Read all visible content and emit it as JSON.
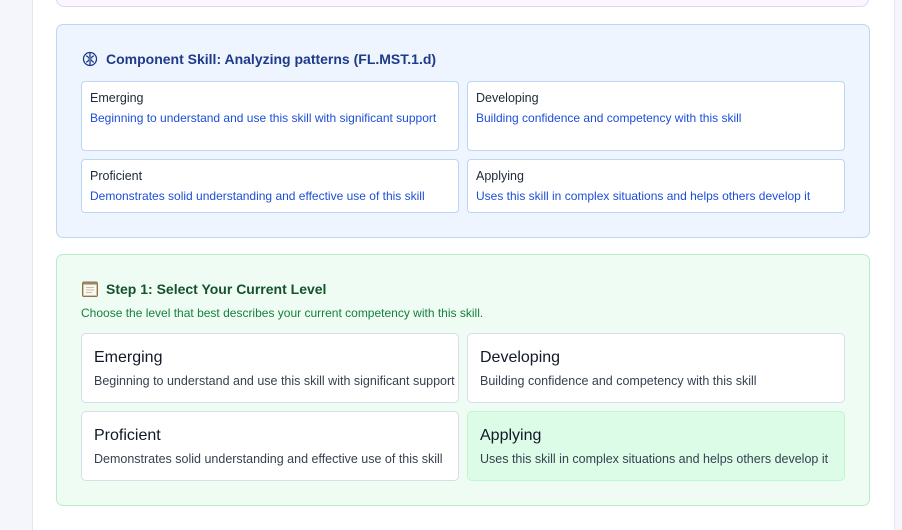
{
  "component": {
    "title": "Component Skill: Analyzing patterns (FL.MST.1.d)",
    "levels": [
      {
        "name": "Emerging",
        "desc": "Beginning to understand and use this skill with significant support"
      },
      {
        "name": "Developing",
        "desc": "Building confidence and competency with this skill"
      },
      {
        "name": "Proficient",
        "desc": "Demonstrates solid understanding and effective use of this skill"
      },
      {
        "name": "Applying",
        "desc": "Uses this skill in complex situations and helps others develop it"
      }
    ]
  },
  "step": {
    "title": "Step 1: Select Your Current Level",
    "description": "Choose the level that best describes your current competency with this skill.",
    "options": [
      {
        "name": "Emerging",
        "desc": "Beginning to understand and use this skill with significant support"
      },
      {
        "name": "Developing",
        "desc": "Building confidence and competency with this skill"
      },
      {
        "name": "Proficient",
        "desc": "Demonstrates solid understanding and effective use of this skill"
      },
      {
        "name": "Applying",
        "desc": "Uses this skill in complex situations and helps others develop it"
      }
    ],
    "selected": "Applying"
  },
  "icons": {
    "component": "brain-icon",
    "step": "clipboard-icon"
  },
  "colors": {
    "component_bg": "#eef5ff",
    "step_bg": "#effcf3",
    "selected_bg": "#dcfce7",
    "accent_blue": "#1d4ed8",
    "accent_green": "#15803d"
  }
}
